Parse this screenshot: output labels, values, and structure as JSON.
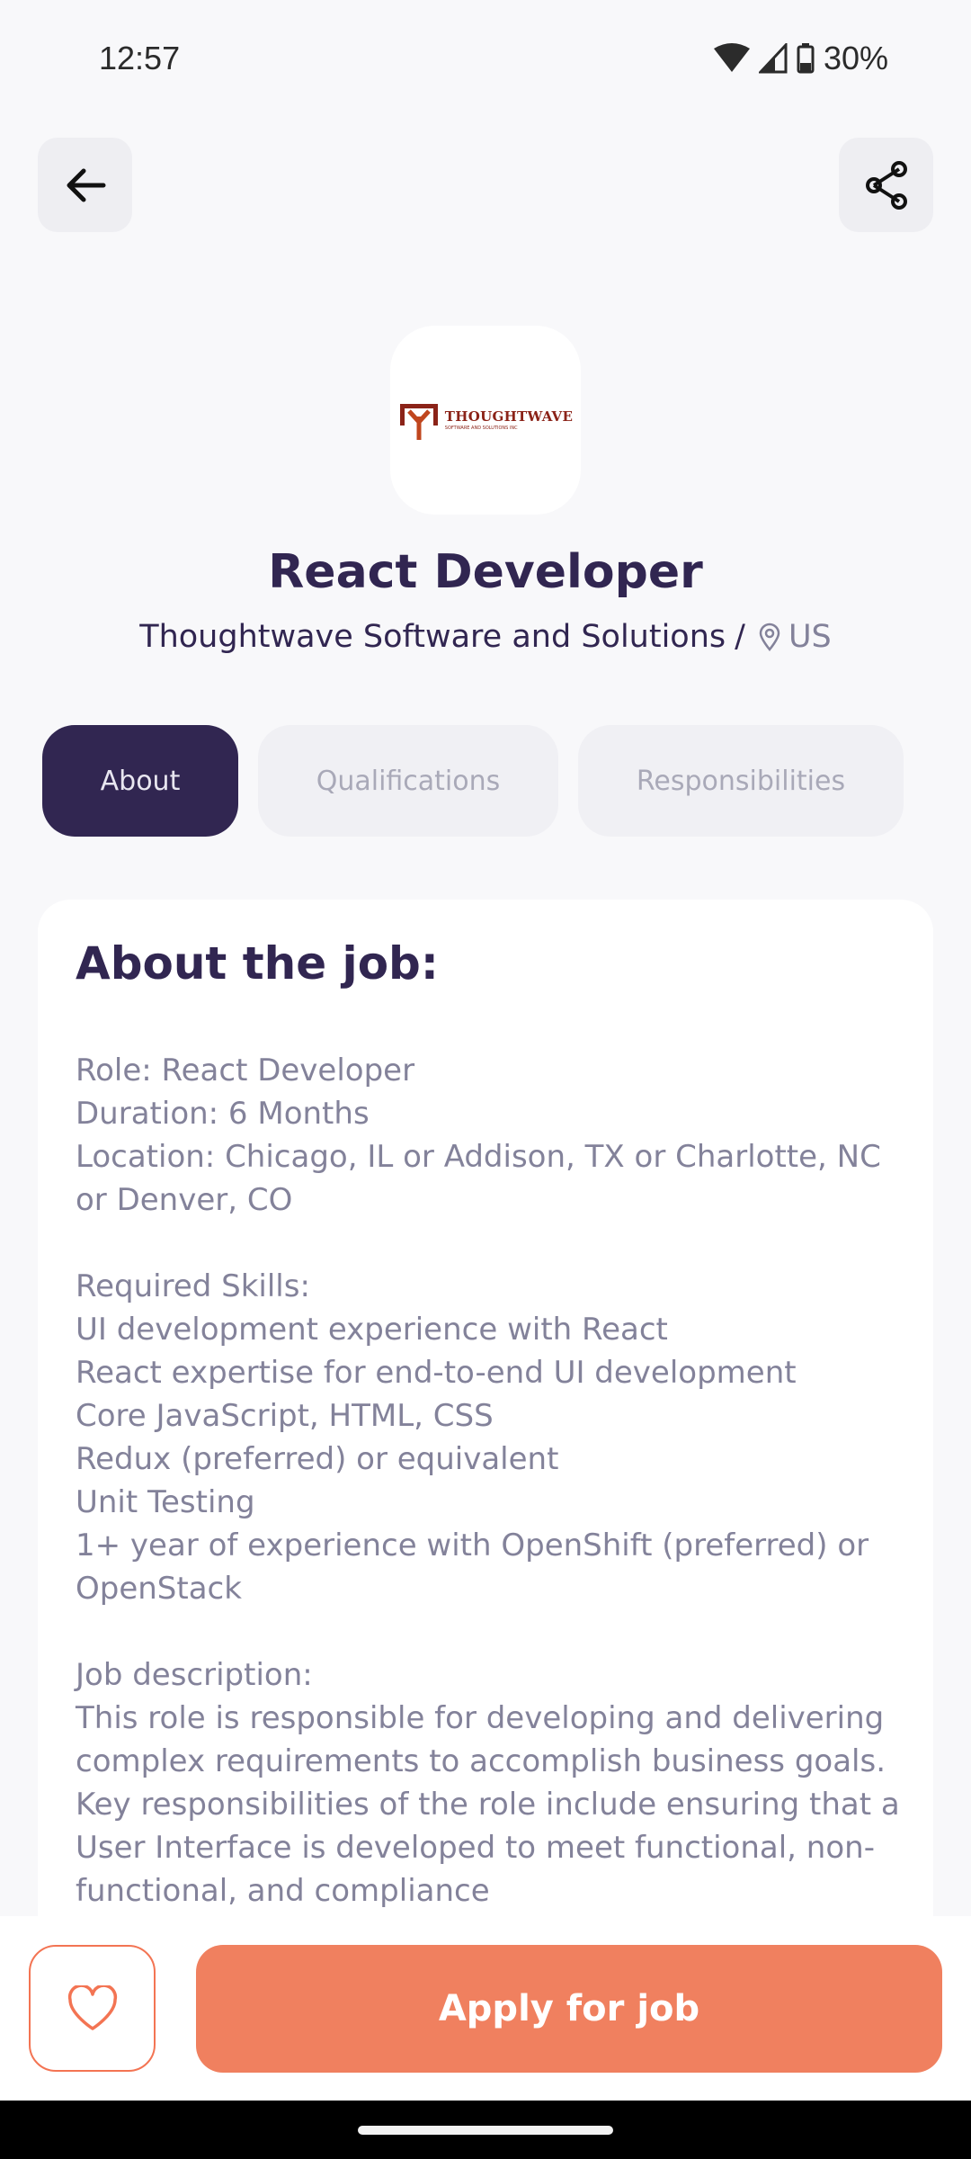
{
  "status_bar": {
    "time": "12:57",
    "battery": "30%"
  },
  "header": {
    "back_icon": "arrow-left-icon",
    "share_icon": "share-icon"
  },
  "company": {
    "logo_word": "THOUGHTWAVE",
    "logo_sub": "SOFTWARE AND SOLUTIONS INC",
    "name": "Thoughtwave Software and Solutions",
    "separator": "/",
    "location": "US"
  },
  "job": {
    "title": "React Developer"
  },
  "tabs": [
    {
      "label": "About",
      "active": true
    },
    {
      "label": "Qualifications",
      "active": false
    },
    {
      "label": "Responsibilities",
      "active": false
    }
  ],
  "about": {
    "heading": "About the job:",
    "body": "Role: React Developer\nDuration: 6 Months\nLocation: Chicago, IL or Addison, TX or Charlotte, NC or Denver, CO\n\nRequired Skills:\nUI development experience with React\nReact expertise for end-to-end UI development\nCore JavaScript, HTML, CSS\nRedux (preferred) or equivalent\nUnit Testing\n1+ year of experience with OpenShift (preferred) or OpenStack\n\nJob description:\nThis role is responsible for developing and delivering complex requirements to accomplish business goals. Key responsibilities of the role include ensuring that a User Interface is developed to meet functional, non-functional, and compliance"
  },
  "footer": {
    "like_icon": "heart-icon",
    "apply_label": "Apply for job"
  },
  "colors": {
    "primary": "#312651",
    "accent": "#F0805F",
    "text_muted": "#83829A"
  }
}
